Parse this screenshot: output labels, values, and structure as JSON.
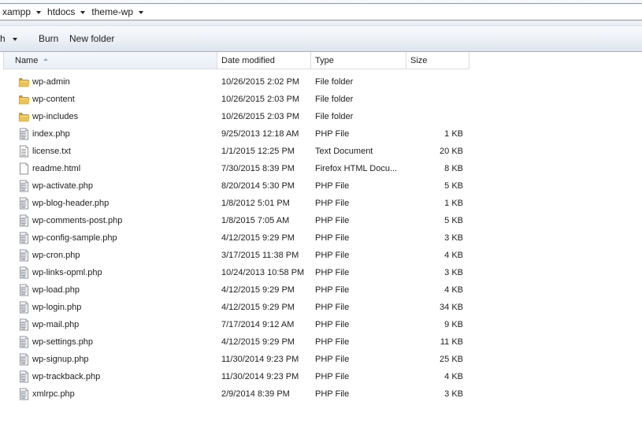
{
  "breadcrumb": [
    {
      "label": "xampp"
    },
    {
      "label": "htdocs"
    },
    {
      "label": "theme-wp"
    }
  ],
  "toolbar": {
    "share_label": "ith",
    "burn_label": "Burn",
    "new_folder_label": "New folder"
  },
  "columns": {
    "name": "Name",
    "date": "Date modified",
    "type": "Type",
    "size": "Size"
  },
  "files": [
    {
      "name": "wp-admin",
      "date": "10/26/2015 2:02 PM",
      "type": "File folder",
      "size": "",
      "icon": "folder-icon"
    },
    {
      "name": "wp-content",
      "date": "10/26/2015 2:03 PM",
      "type": "File folder",
      "size": "",
      "icon": "folder-icon"
    },
    {
      "name": "wp-includes",
      "date": "10/26/2015 2:03 PM",
      "type": "File folder",
      "size": "",
      "icon": "folder-icon"
    },
    {
      "name": "index.php",
      "date": "9/25/2013 12:18 AM",
      "type": "PHP File",
      "size": "1 KB",
      "icon": "php-file-icon"
    },
    {
      "name": "license.txt",
      "date": "1/1/2015 12:25 PM",
      "type": "Text Document",
      "size": "20 KB",
      "icon": "text-file-icon"
    },
    {
      "name": "readme.html",
      "date": "7/30/2015 8:39 PM",
      "type": "Firefox HTML Docu...",
      "size": "8 KB",
      "icon": "html-file-icon"
    },
    {
      "name": "wp-activate.php",
      "date": "8/20/2014 5:30 PM",
      "type": "PHP File",
      "size": "5 KB",
      "icon": "php-file-icon"
    },
    {
      "name": "wp-blog-header.php",
      "date": "1/8/2012 5:01 PM",
      "type": "PHP File",
      "size": "1 KB",
      "icon": "php-file-icon"
    },
    {
      "name": "wp-comments-post.php",
      "date": "1/8/2015 7:05 AM",
      "type": "PHP File",
      "size": "5 KB",
      "icon": "php-file-icon"
    },
    {
      "name": "wp-config-sample.php",
      "date": "4/12/2015 9:29 PM",
      "type": "PHP File",
      "size": "3 KB",
      "icon": "php-file-icon"
    },
    {
      "name": "wp-cron.php",
      "date": "3/17/2015 11:38 PM",
      "type": "PHP File",
      "size": "4 KB",
      "icon": "php-file-icon"
    },
    {
      "name": "wp-links-opml.php",
      "date": "10/24/2013 10:58 PM",
      "type": "PHP File",
      "size": "3 KB",
      "icon": "php-file-icon"
    },
    {
      "name": "wp-load.php",
      "date": "4/12/2015 9:29 PM",
      "type": "PHP File",
      "size": "4 KB",
      "icon": "php-file-icon"
    },
    {
      "name": "wp-login.php",
      "date": "4/12/2015 9:29 PM",
      "type": "PHP File",
      "size": "34 KB",
      "icon": "php-file-icon"
    },
    {
      "name": "wp-mail.php",
      "date": "7/17/2014 9:12 AM",
      "type": "PHP File",
      "size": "9 KB",
      "icon": "php-file-icon"
    },
    {
      "name": "wp-settings.php",
      "date": "4/12/2015 9:29 PM",
      "type": "PHP File",
      "size": "11 KB",
      "icon": "php-file-icon"
    },
    {
      "name": "wp-signup.php",
      "date": "11/30/2014 9:23 PM",
      "type": "PHP File",
      "size": "25 KB",
      "icon": "php-file-icon"
    },
    {
      "name": "wp-trackback.php",
      "date": "11/30/2014 9:23 PM",
      "type": "PHP File",
      "size": "4 KB",
      "icon": "php-file-icon"
    },
    {
      "name": "xmlrpc.php",
      "date": "2/9/2014 8:39 PM",
      "type": "PHP File",
      "size": "3 KB",
      "icon": "php-file-icon"
    }
  ],
  "colors": {
    "folder": "#e8c45a",
    "folder_dark": "#c99a2e",
    "header_border": "#d9dde3",
    "toolbar_bottom": "#a8b2c1"
  }
}
